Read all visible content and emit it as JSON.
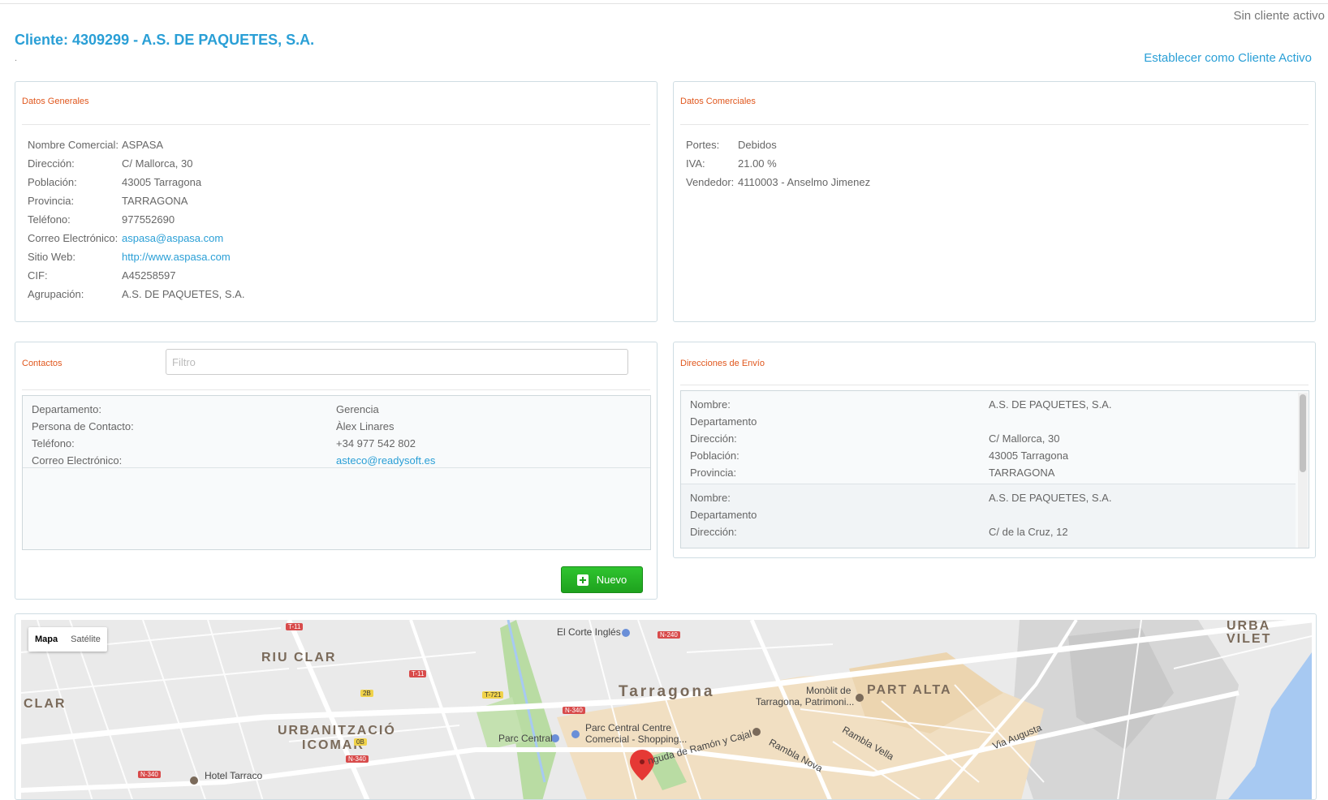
{
  "header": {
    "no_client": "Sin cliente activo",
    "client_title": "Cliente: 4309299 - A.S. DE PAQUETES, S.A.",
    "dot": ".",
    "set_active": "Establecer como Cliente Activo"
  },
  "general": {
    "title": "Datos Generales",
    "rows": [
      {
        "k": "Nombre Comercial:",
        "v": "ASPASA"
      },
      {
        "k": "Dirección:",
        "v": "C/ Mallorca, 30"
      },
      {
        "k": "Población:",
        "v": "43005 Tarragona"
      },
      {
        "k": "Provincia:",
        "v": "TARRAGONA"
      },
      {
        "k": "Teléfono:",
        "v": "977552690"
      },
      {
        "k": "Correo Electrónico:",
        "v": "aspasa@aspasa.com"
      },
      {
        "k": "Sitio Web:",
        "v": "http://www.aspasa.com"
      },
      {
        "k": "CIF:",
        "v": "A45258597"
      },
      {
        "k": "Agrupación:",
        "v": "A.S. DE PAQUETES, S.A."
      }
    ]
  },
  "commercial": {
    "title": "Datos Comerciales",
    "rows": [
      {
        "k": "Portes:",
        "v": "Debidos"
      },
      {
        "k": "IVA:",
        "v": "21.00 %"
      },
      {
        "k": "Vendedor:",
        "v": "4110003 - Anselmo Jimenez"
      }
    ]
  },
  "contacts": {
    "title": "Contactos",
    "filter_placeholder": "Filtro",
    "items": [
      {
        "k": "Departamento:",
        "v": "Gerencia"
      },
      {
        "k": "Persona de Contacto:",
        "v": "Àlex Linares"
      },
      {
        "k": "Teléfono:",
        "v": "+34 977 542 802"
      },
      {
        "k": "Correo Electrónico:",
        "v": "asteco@readysoft.es"
      }
    ],
    "new_label": "Nuevo"
  },
  "shipping": {
    "title": "Direcciones de Envío",
    "first": [
      {
        "k": "Nombre:",
        "v": "A.S. DE PAQUETES, S.A."
      },
      {
        "k": "Departamento",
        "v": ""
      },
      {
        "k": "Dirección:",
        "v": "C/ Mallorca, 30"
      },
      {
        "k": "Población:",
        "v": "43005 Tarragona"
      },
      {
        "k": "Provincia:",
        "v": "TARRAGONA"
      }
    ],
    "second": [
      {
        "k": "Nombre:",
        "v": "A.S. DE PAQUETES, S.A."
      },
      {
        "k": "Departamento",
        "v": ""
      },
      {
        "k": "Dirección:",
        "v": "C/ de la Cruz, 12"
      }
    ]
  },
  "map": {
    "type_map": "Mapa",
    "type_satellite": "Satélite",
    "labels": {
      "tarragona": "Tarragona",
      "riu_clar": "RIU CLAR",
      "clar": "CLAR",
      "part_alta": "PART ALTA",
      "urbanitzacio": "URBANITZACIÓ",
      "icomar": "ICOMAR",
      "corte_ingles": "El Corte Inglés",
      "parc_central": "Parc Central",
      "parc_central_centre": "Parc Central Centre",
      "comercial_shopping": "Comercial - Shopping...",
      "monolit": "Monòlit de",
      "tarragona_patrimoni": "Tarragona, Patrimoni...",
      "rambla_nova": "Rambla Nova",
      "rambla_vella": "Rambla Vella",
      "via_augusta": "Via Augusta",
      "hotel_tarraco": "Hotel Tarraco",
      "ramon_cajal": "nguda de Ramón y Cajal",
      "urba_vilet": "URBA VILET"
    },
    "roads": {
      "t11a": "T-11",
      "t11b": "T-11",
      "n240": "N-240",
      "n340a": "N-340",
      "n340b": "N-340",
      "n340c": "N-340",
      "t721": "T-721",
      "r2b": "2B",
      "r0b": "0B"
    }
  }
}
